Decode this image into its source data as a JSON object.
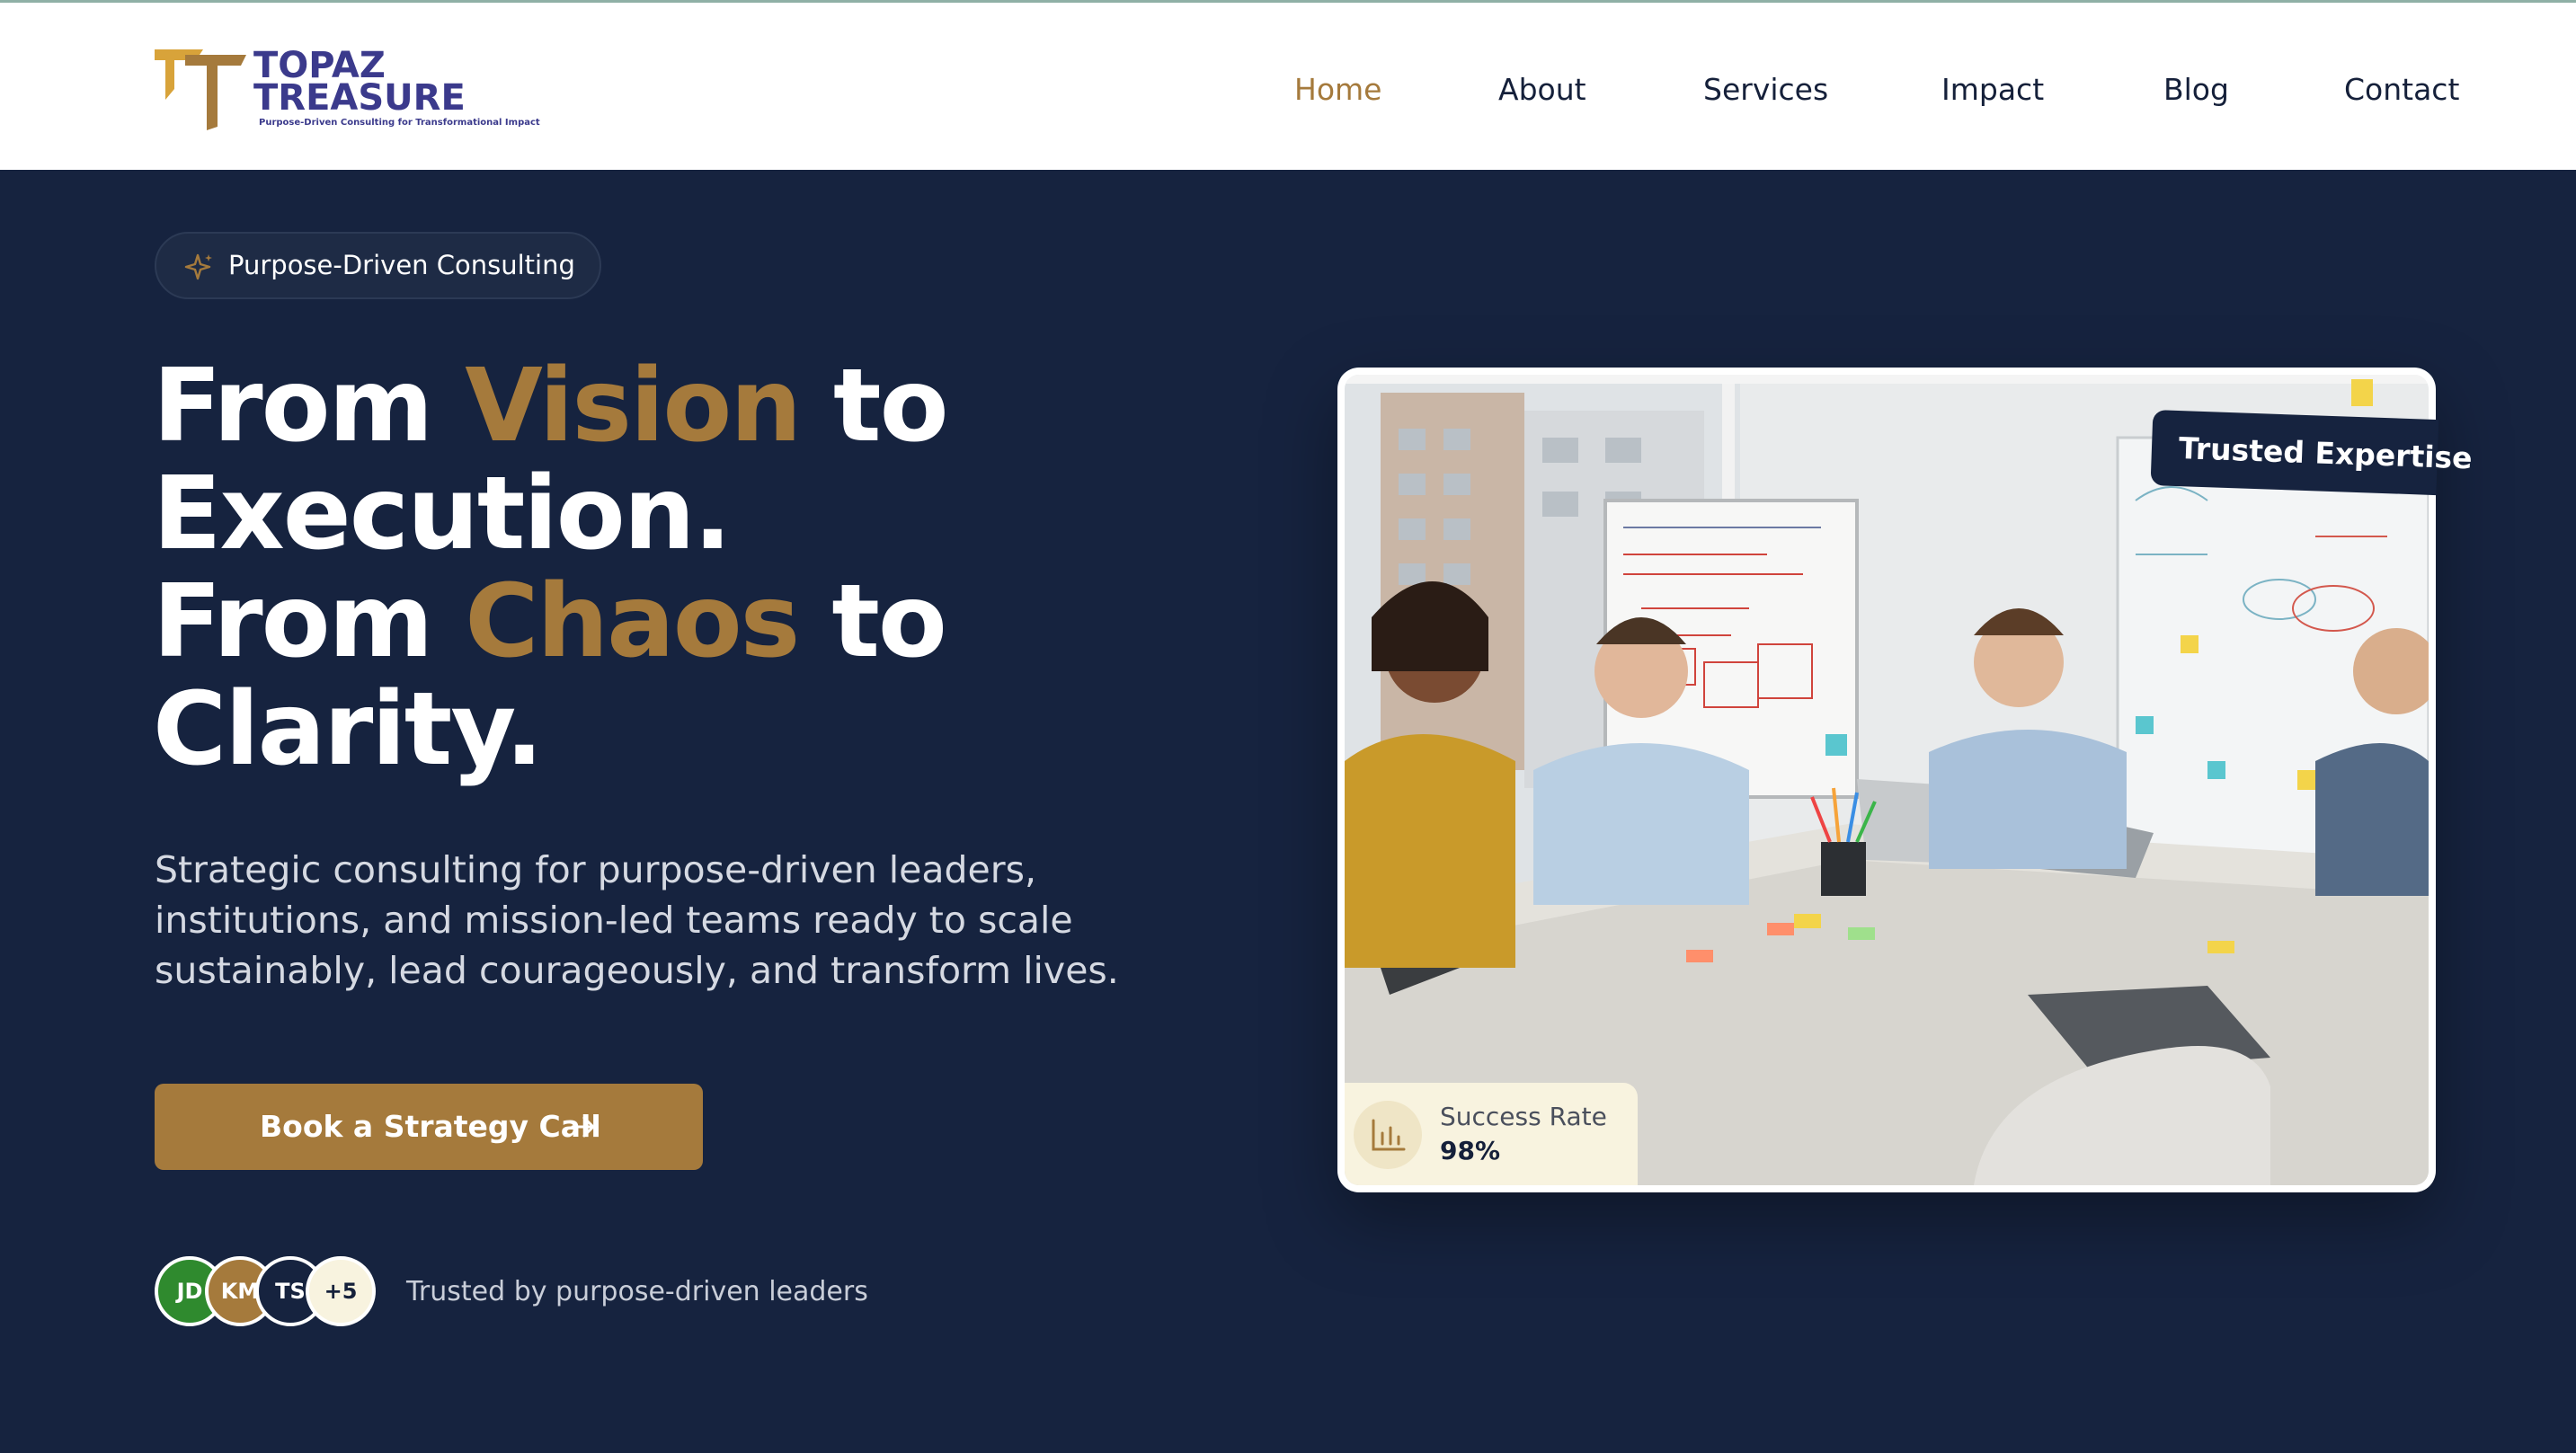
{
  "brand": {
    "line1": "TOPAZ",
    "line2": "TREASURE",
    "tagline": "Purpose-Driven Consulting for Transformational Impact",
    "colors": {
      "navy": "#16233f",
      "gold": "#a57a3c",
      "logo_text": "#3b3a8c",
      "white": "#ffffff"
    }
  },
  "nav": {
    "items": [
      {
        "label": "Home",
        "active": true
      },
      {
        "label": "About",
        "active": false
      },
      {
        "label": "Services",
        "active": false
      },
      {
        "label": "Impact",
        "active": false
      },
      {
        "label": "Blog",
        "active": false
      },
      {
        "label": "Contact",
        "active": false
      }
    ]
  },
  "hero": {
    "pill": {
      "icon": "sparkle-icon",
      "label": "Purpose-Driven Consulting"
    },
    "headline": {
      "l1_a": "From ",
      "l1_gold": "Vision",
      "l1_b": " to",
      "l2": "Execution.",
      "l3_a": "From ",
      "l3_gold": "Chaos",
      "l3_b": " to",
      "l4": "Clarity."
    },
    "subtext": "Strategic consulting for purpose-driven leaders, institutions, and mission-led teams ready to scale sustainably, lead courageously, and transform lives.",
    "cta": {
      "label": "Book a Strategy Call",
      "icon": "arrow-right-icon"
    },
    "social_proof": {
      "avatars": [
        {
          "initials": "JD",
          "color": "#2f8a2e"
        },
        {
          "initials": "KM",
          "color": "#a57a3c"
        },
        {
          "initials": "TS",
          "color": "#16233f"
        },
        {
          "initials": "+5",
          "color": "#f8f3df"
        }
      ],
      "text": "Trusted by purpose-driven leaders"
    }
  },
  "photo_card": {
    "badge": "Trusted Expertise",
    "stat": {
      "icon": "bar-chart-icon",
      "label": "Success Rate",
      "value": "98%"
    }
  }
}
